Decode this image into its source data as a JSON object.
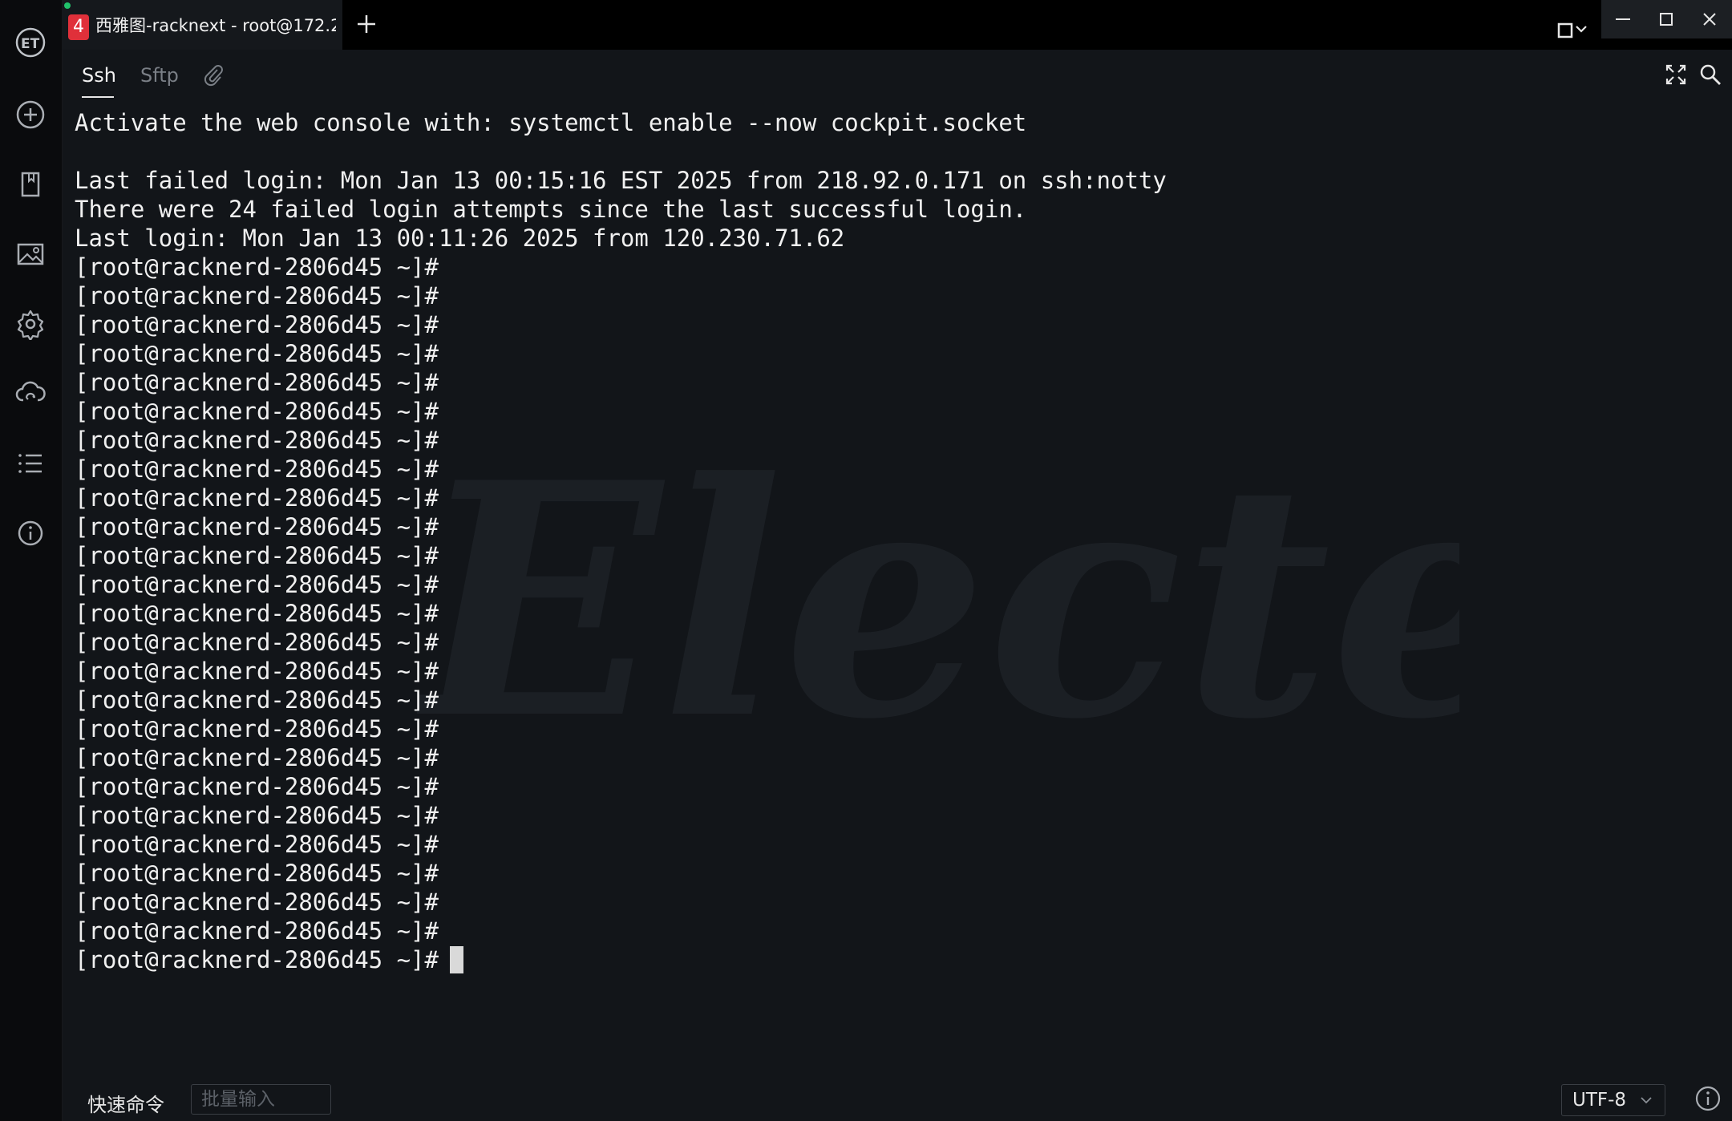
{
  "sidebar": {
    "items": [
      {
        "name": "logo",
        "icon": "electerm-logo-icon"
      },
      {
        "name": "new-bookmark",
        "icon": "plus-circle-icon"
      },
      {
        "name": "bookmarks",
        "icon": "bookmark-icon"
      },
      {
        "name": "terminal-themes",
        "icon": "picture-icon"
      },
      {
        "name": "settings",
        "icon": "gear-icon"
      },
      {
        "name": "cloud-sync",
        "icon": "cloud-sync-icon"
      },
      {
        "name": "batch-operation",
        "icon": "list-icon"
      },
      {
        "name": "about",
        "icon": "info-icon"
      }
    ]
  },
  "tab": {
    "badge": "4",
    "title": "西雅图-racknext - root@172.2..."
  },
  "subtabs": {
    "ssh": "Ssh",
    "sftp": "Sftp"
  },
  "terminal": {
    "lines": [
      "Activate the web console with: systemctl enable --now cockpit.socket",
      "",
      "Last failed login: Mon Jan 13 00:15:16 EST 2025 from 218.92.0.171 on ssh:notty",
      "There were 24 failed login attempts since the last successful login.",
      "Last login: Mon Jan 13 00:11:26 2025 from 120.230.71.62",
      "[root@racknerd-2806d45 ~]#",
      "[root@racknerd-2806d45 ~]#",
      "[root@racknerd-2806d45 ~]#",
      "[root@racknerd-2806d45 ~]#",
      "[root@racknerd-2806d45 ~]#",
      "[root@racknerd-2806d45 ~]#",
      "[root@racknerd-2806d45 ~]#",
      "[root@racknerd-2806d45 ~]#",
      "[root@racknerd-2806d45 ~]#",
      "[root@racknerd-2806d45 ~]#",
      "[root@racknerd-2806d45 ~]#",
      "[root@racknerd-2806d45 ~]#",
      "[root@racknerd-2806d45 ~]#",
      "[root@racknerd-2806d45 ~]#",
      "[root@racknerd-2806d45 ~]#",
      "[root@racknerd-2806d45 ~]#",
      "[root@racknerd-2806d45 ~]#",
      "[root@racknerd-2806d45 ~]#",
      "[root@racknerd-2806d45 ~]#",
      "[root@racknerd-2806d45 ~]#",
      "[root@racknerd-2806d45 ~]#",
      "[root@racknerd-2806d45 ~]#",
      "[root@racknerd-2806d45 ~]#",
      "[root@racknerd-2806d45 ~]#"
    ],
    "prompt": "[root@racknerd-2806d45 ~]#",
    "watermark": "Electerm"
  },
  "footer": {
    "quick_command": "快速命令",
    "batch_input_placeholder": "批量输入",
    "encoding": "UTF-8"
  },
  "colors": {
    "terminal_bg": "#121519",
    "sidebar_bg": "#0a0b0d",
    "tab_badge": "#e0303a",
    "active_dot": "#21c26b"
  }
}
